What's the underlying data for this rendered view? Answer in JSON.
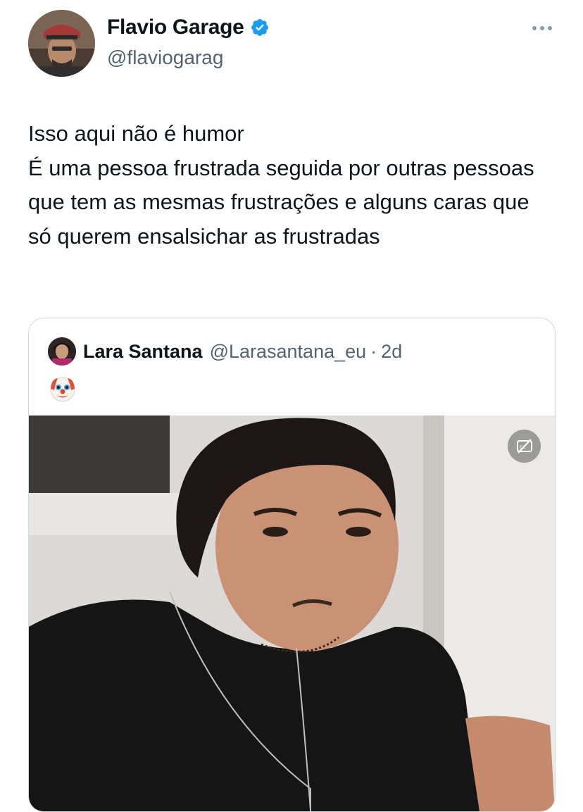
{
  "author": {
    "display_name": "Flavio Garage",
    "handle": "@flaviogarag",
    "verified": true,
    "avatar_icon": "user-avatar-photo"
  },
  "menu": {
    "icon": "more-horizontal-icon"
  },
  "tweet": {
    "text": "Isso aqui não é humor\nÉ uma pessoa frustrada seguida por outras pessoas que tem as mesmas frustrações e alguns caras que só querem ensalsichar as frustradas"
  },
  "quote": {
    "display_name": "Lara Santana",
    "handle": "@Larasantana_eu",
    "separator": "·",
    "time": "2d",
    "emoji_icon": "clown-face-emoji",
    "media": {
      "type": "video",
      "caption_icon": "closed-captions-off-icon"
    }
  },
  "colors": {
    "text_primary": "#0f1419",
    "text_secondary": "#536471",
    "verified_blue": "#1d9bf0",
    "border": "#cfd9de"
  }
}
